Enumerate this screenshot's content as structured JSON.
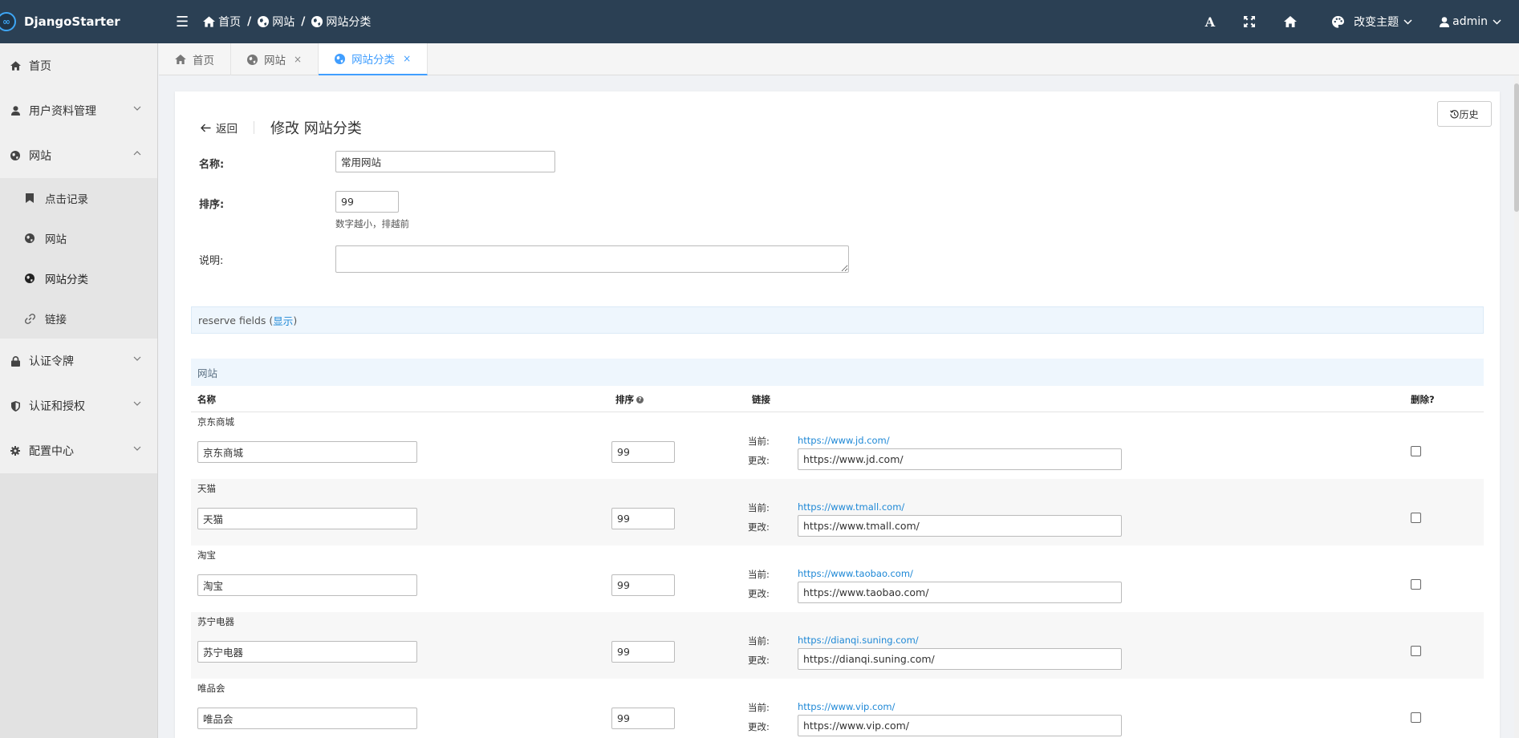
{
  "brand": {
    "name": "DjangoStarter",
    "logo_glyph": "∞"
  },
  "breadcrumb": [
    {
      "label": "首页",
      "icon": "home-icon"
    },
    {
      "label": "网站",
      "icon": "globe-icon"
    },
    {
      "label": "网站分类",
      "icon": "globe-icon"
    }
  ],
  "topbar": {
    "font_icon": "A",
    "theme_label": "改变主题",
    "user_label": "admin"
  },
  "sidebar": {
    "home": "首页",
    "user_profile": "用户资料管理",
    "website": "网站",
    "website_sub": [
      "点击记录",
      "网站",
      "网站分类",
      "链接"
    ],
    "auth_token": "认证令牌",
    "auth": "认证和授权",
    "config": "配置中心"
  },
  "tabs": [
    {
      "label": "首页",
      "icon": "home-icon"
    },
    {
      "label": "网站",
      "icon": "globe-icon",
      "close": "×"
    },
    {
      "label": "网站分类",
      "icon": "globe-icon",
      "close": "×"
    }
  ],
  "page": {
    "back_label": "返回",
    "title": "修改 网站分类",
    "history_label": "历史",
    "name_label": "名称:",
    "name_value": "常用网站",
    "order_label": "排序:",
    "order_value": "99",
    "order_help": "数字越小，排越前",
    "desc_label": "说明:",
    "reserve_text": "reserve fields (",
    "reserve_link": "显示",
    "reserve_close": ")",
    "inline_title": "网站"
  },
  "table": {
    "headers": {
      "name": "名称",
      "order": "排序",
      "order_help_icon": "?",
      "url": "链接",
      "delete": "删除?"
    },
    "current_label": "当前:",
    "change_label": "更改:",
    "rows": [
      {
        "name": "京东商城",
        "order": "99",
        "url": "https://www.jd.com/"
      },
      {
        "name": "天猫",
        "order": "99",
        "url": "https://www.tmall.com/"
      },
      {
        "name": "淘宝",
        "order": "99",
        "url": "https://www.taobao.com/"
      },
      {
        "name": "苏宁电器",
        "order": "99",
        "url": "https://dianqi.suning.com/"
      },
      {
        "name": "唯品会",
        "order": "99",
        "url": "https://www.vip.com/"
      }
    ]
  },
  "colors": {
    "topbar": "#2b4054",
    "accent": "#409eff",
    "link": "#1e88d6"
  }
}
